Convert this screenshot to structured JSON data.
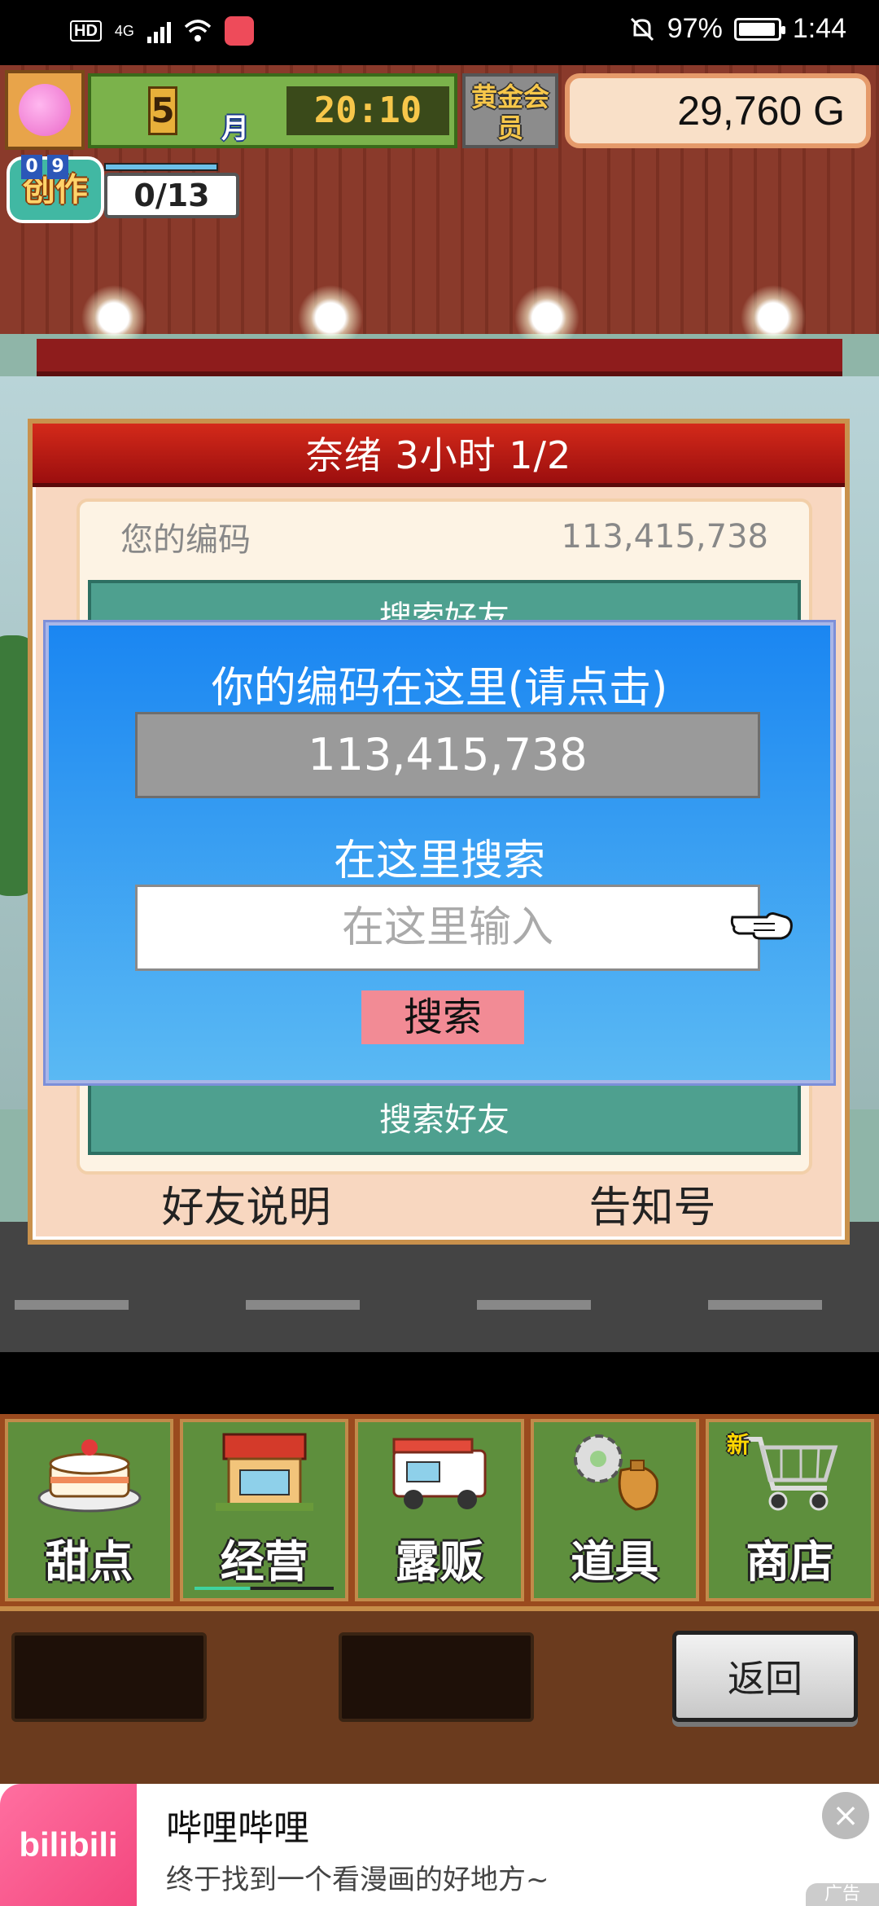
{
  "status_bar": {
    "network_badge": "HD",
    "network_type": "4G",
    "battery_percent": "97%",
    "time": "1:44"
  },
  "hud": {
    "month_number": "5",
    "month_label": "月",
    "game_time": "20:10",
    "membership_badge": "黄金会员",
    "money": "29,760 G",
    "create_level_digits": [
      "0",
      "9"
    ],
    "create_label": "创作",
    "create_count": "0/13"
  },
  "panel": {
    "title": "奈绪  3小时 1/2",
    "code_label": "您的编码",
    "code_value": "113,415,738",
    "search_friend_label": "搜索好友",
    "friend_explain_link": "好友说明",
    "notice_link": "告知号"
  },
  "dialog": {
    "title": "你的编码在这里(请点击)",
    "code_value": "113,415,738",
    "search_heading": "在这里搜索",
    "input_placeholder": "在这里输入",
    "input_value": "",
    "search_button": "搜索"
  },
  "menu": {
    "items": [
      {
        "label": "甜点",
        "icon": "cake-icon"
      },
      {
        "label": "经营",
        "icon": "shop-building-icon"
      },
      {
        "label": "露贩",
        "icon": "food-truck-icon"
      },
      {
        "label": "道具",
        "icon": "gear-sack-icon"
      },
      {
        "label": "商店",
        "icon": "shopping-cart-icon",
        "badge": "新"
      }
    ],
    "back_button": "返回"
  },
  "ad": {
    "logo_text": "bilibili",
    "title": "哔哩哔哩",
    "description": "终于找到一个看漫画的好地方~",
    "close_symbol": "×",
    "tag": "广告"
  }
}
